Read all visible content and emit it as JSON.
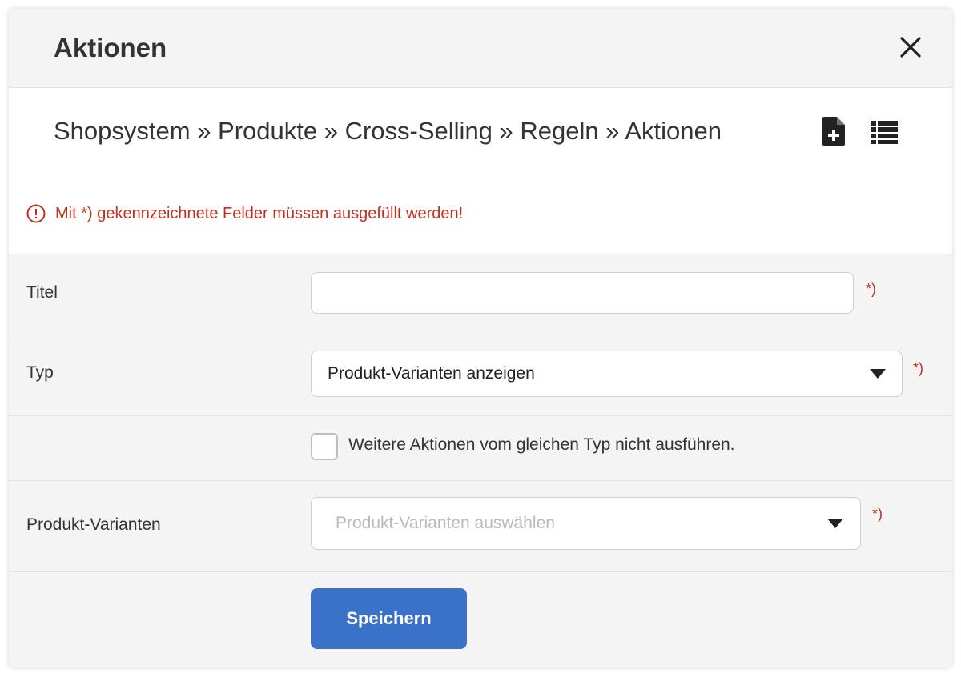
{
  "dialog": {
    "title": "Aktionen",
    "close_icon": "close-icon"
  },
  "breadcrumb": {
    "text": "Shopsystem » Produkte » Cross-Selling » Regeln » Aktionen"
  },
  "toolbar": {
    "icons": [
      "new-document-icon",
      "list-icon"
    ]
  },
  "alert": {
    "icon": "exclamation-circle-icon",
    "text": "Mit *) gekennzeichnete Felder müssen ausgefüllt werden!",
    "color": "#c0301f"
  },
  "form": {
    "required_marker": "*)",
    "title_field": {
      "label": "Titel",
      "value": ""
    },
    "type_field": {
      "label": "Typ",
      "selected": "Produkt-Varianten anzeigen"
    },
    "skip_checkbox": {
      "label": "Weitere Aktionen vom gleichen Typ nicht ausführen.",
      "checked": false
    },
    "variants_field": {
      "label": "Produkt-Varianten",
      "placeholder": "Produkt-Varianten auswählen"
    },
    "save_label": "Speichern"
  },
  "colors": {
    "accent": "#3a72c9",
    "required": "#c0301f",
    "panel_bg": "#f4f4f4"
  }
}
